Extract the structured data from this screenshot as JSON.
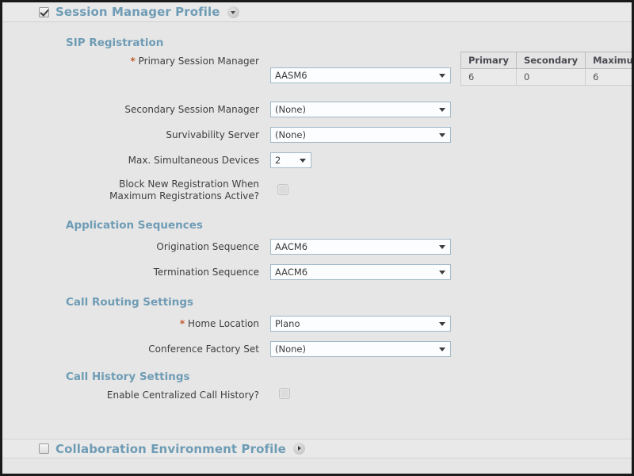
{
  "sections": {
    "session_manager_profile": {
      "title": "Session Manager Profile",
      "checked": true,
      "expanded": true,
      "groups": {
        "sip_registration": {
          "title": "SIP Registration",
          "fields": {
            "primary_session_manager": {
              "label": "Primary Session Manager",
              "required_marker": "*",
              "value": "AASM6"
            },
            "secondary_session_manager": {
              "label": "Secondary Session Manager",
              "value": "(None)"
            },
            "survivability_server": {
              "label": "Survivability Server",
              "value": "(None)"
            },
            "max_simultaneous_devices": {
              "label": "Max. Simultaneous Devices",
              "value": "2"
            },
            "block_new_registration": {
              "label": "Block New Registration When Maximum Registrations Active?",
              "checked": false
            }
          },
          "registration_table": {
            "headers": [
              "Primary",
              "Secondary",
              "Maximum"
            ],
            "rows": [
              [
                "6",
                "0",
                "6"
              ]
            ]
          }
        },
        "application_sequences": {
          "title": "Application Sequences",
          "fields": {
            "origination_sequence": {
              "label": "Origination Sequence",
              "value": "AACM6"
            },
            "termination_sequence": {
              "label": "Termination Sequence",
              "value": "AACM6"
            }
          }
        },
        "call_routing_settings": {
          "title": "Call Routing Settings",
          "fields": {
            "home_location": {
              "label": "Home Location",
              "required_marker": "*",
              "value": "Plano"
            },
            "conference_factory_set": {
              "label": "Conference Factory Set",
              "value": "(None)"
            }
          }
        },
        "call_history_settings": {
          "title": "Call History Settings",
          "fields": {
            "enable_centralized_call_history": {
              "label": "Enable Centralized Call History?",
              "checked": false
            }
          }
        }
      }
    },
    "collaboration_environment_profile": {
      "title": "Collaboration Environment Profile",
      "checked": false,
      "expanded": false
    }
  },
  "colors": {
    "heading": "#6f9cb5",
    "required": "#c35a2b",
    "page_background": "#e6e6e6",
    "field_border": "#a3b9c8"
  }
}
